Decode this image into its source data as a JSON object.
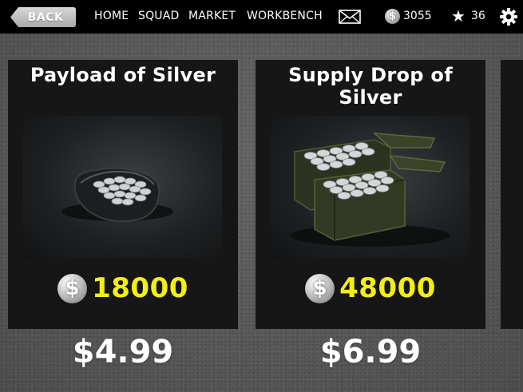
{
  "topbar": {
    "back_label": "BACK",
    "nav": [
      "HOME",
      "SQUAD",
      "MARKET",
      "WORKBENCH"
    ],
    "coins": "3055",
    "stars": "36",
    "icons": [
      "mail-icon",
      "coin-icon",
      "star-icon",
      "gear-icon"
    ]
  },
  "products": [
    {
      "title": "Payload of Silver",
      "silver": "18000",
      "price": "$4.99",
      "image": "silver-pouch"
    },
    {
      "title": "Supply Drop of Silver",
      "silver": "48000",
      "price": "$6.99",
      "image": "silver-crate"
    }
  ],
  "coin_symbol": "$",
  "colors": {
    "topbar": "#000000",
    "card": "#161616",
    "silver_amount": "#f4ef12",
    "background": "#595959"
  }
}
